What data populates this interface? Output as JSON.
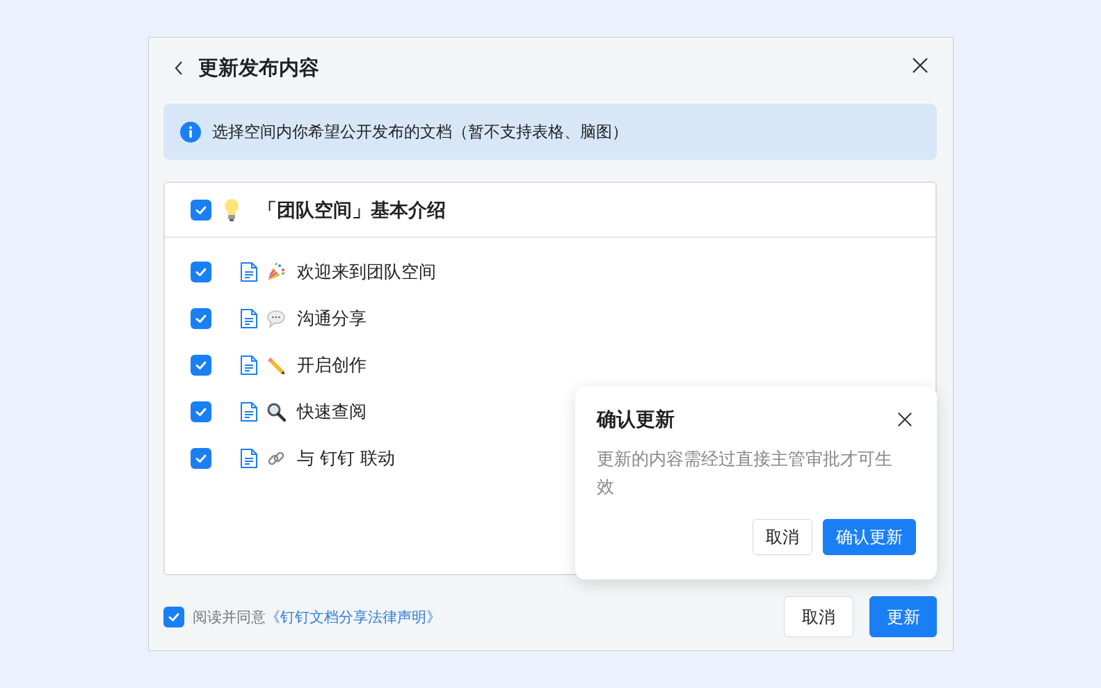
{
  "dialog": {
    "title": "更新发布内容"
  },
  "notice": "选择空间内你希望公开发布的文档（暂不支持表格、脑图）",
  "space": {
    "title": "「团队空间」基本介绍",
    "checked": true
  },
  "documents": [
    {
      "title": "欢迎来到团队空间",
      "checked": true
    },
    {
      "title": "沟通分享",
      "checked": true
    },
    {
      "title": "开启创作",
      "checked": true
    },
    {
      "title": "快速查阅",
      "checked": true
    },
    {
      "title": "与 钉钉 联动",
      "checked": true
    }
  ],
  "agreement": {
    "checked": true,
    "text": "阅读并同意",
    "link": "《钉钉文档分享法律声明》"
  },
  "buttons": {
    "cancel": "取消",
    "confirm": "更新"
  },
  "popover": {
    "title": "确认更新",
    "message": "更新的内容需经过直接主管审批才可生效",
    "cancel": "取消",
    "confirm": "确认更新"
  }
}
